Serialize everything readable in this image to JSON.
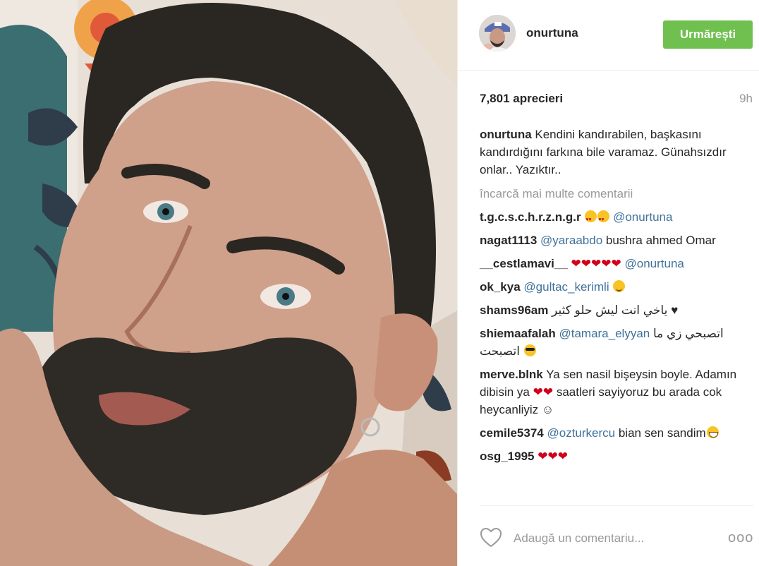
{
  "post": {
    "author": "onurtuna",
    "follow_label": "Urmărești",
    "likes_label": "7,801 aprecieri",
    "time_label": "9h",
    "caption_user": "onurtuna",
    "caption_text": "Kendini kandırabilen, başkasını kandırdığını farkına bile varamaz. Günahsızdır onlar.. Yazıktır..",
    "load_more_label": "încarcă mai multe comentarii"
  },
  "comments": [
    {
      "user": "t.g.c.s.c.h.r.z.n.g.r",
      "pre": "",
      "mention": "@onurtuna",
      "post": "",
      "hearts": "",
      "emoji_before_mention": "love love"
    },
    {
      "user": "nagat1113",
      "pre": "",
      "mention": "@yaraabdo",
      "post": " bushra ahmed Omar"
    },
    {
      "user": "__cestlamavi__",
      "hearts": "❤❤❤❤❤",
      "mention": "@onurtuna"
    },
    {
      "user": "ok_kya",
      "mention": "@gultac_kerimli"
    },
    {
      "user": "shams96am",
      "text": "ياخي انت ليش حلو كثير",
      "symbol": "♥"
    },
    {
      "user": "shiemaafalah",
      "mention": "@tamara_elyyan",
      "text": "اتصبحي زي ما اتصبحت"
    },
    {
      "user": "merve.blnk",
      "text_a": "Ya sen nasil bişeysin boyle. Adamın dibisin ya",
      "hearts": "❤❤",
      "text_b": "saatleri sayiyoruz bu arada cok heycanliyiz ☺"
    },
    {
      "user": "cemile5374",
      "mention": "@ozturkercu",
      "text": " bian sen sandim"
    },
    {
      "user": "osg_1995",
      "hearts": "❤❤❤"
    }
  ],
  "footer": {
    "comment_placeholder": "Adaugă un comentariu...",
    "more_label": "ooo"
  },
  "icons": {
    "like": "heart-outline-icon",
    "more": "more-options-icon"
  },
  "colors": {
    "follow_button": "#70c050",
    "mention": "#3f729b",
    "muted": "#999999"
  }
}
